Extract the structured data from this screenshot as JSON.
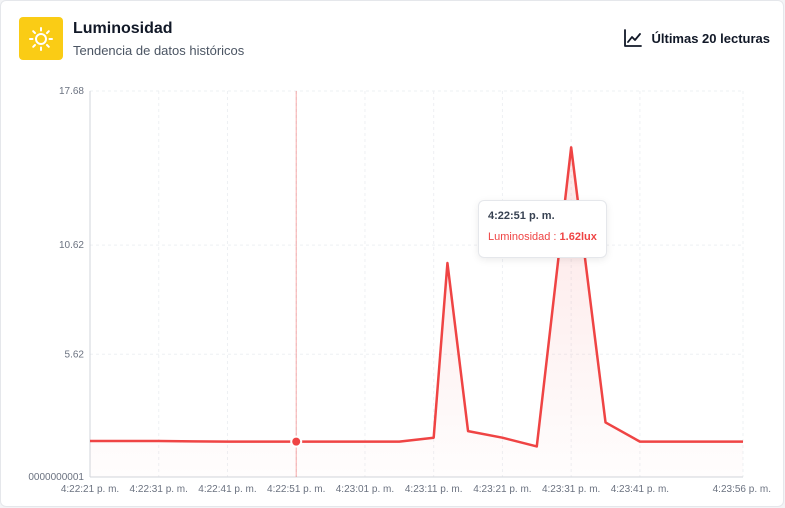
{
  "header": {
    "title": "Luminosidad",
    "subtitle": "Tendencia de datos históricos",
    "range_label": "Últimas 20 lecturas",
    "icon": "sun-icon",
    "range_icon": "line-chart-icon"
  },
  "tooltip": {
    "time": "4:22:51 p. m.",
    "series_label": "Luminosidad",
    "separator": " : ",
    "value": "1.62lux"
  },
  "colors": {
    "accent": "#ef4444",
    "icon_bg": "#facc15"
  },
  "chart_data": {
    "type": "area",
    "title": "",
    "xlabel": "",
    "ylabel": "",
    "ylim": [
      1e-10,
      17.68
    ],
    "y_ticks": [
      "0000000001",
      "5.62",
      "10.62",
      "17.68"
    ],
    "y_tick_values": [
      1e-10,
      5.62,
      10.62,
      17.68
    ],
    "x_tick_labels": [
      "4:22:21 p. m.",
      "4:22:31 p. m.",
      "4:22:41 p. m.",
      "4:22:51 p. m.",
      "4:23:01 p. m.",
      "4:23:11 p. m.",
      "4:23:21 p. m.",
      "4:23:31 p. m.",
      "4:23:41 p. m.",
      "4:23:56 p. m."
    ],
    "x_tick_seconds": [
      0,
      10,
      20,
      30,
      40,
      50,
      60,
      70,
      80,
      95
    ],
    "grid": true,
    "series": [
      {
        "t": [
          0,
          5,
          10,
          15,
          20,
          25,
          30,
          35,
          40,
          45,
          50,
          52,
          55,
          60,
          65,
          70,
          75,
          80,
          85,
          95
        ],
        "values": [
          1.65,
          1.65,
          1.65,
          1.63,
          1.62,
          1.62,
          1.62,
          1.62,
          1.62,
          1.62,
          1.8,
          9.8,
          2.1,
          1.8,
          1.4,
          15.1,
          2.5,
          1.62,
          1.62,
          1.62
        ]
      }
    ],
    "highlight_t": 30
  }
}
